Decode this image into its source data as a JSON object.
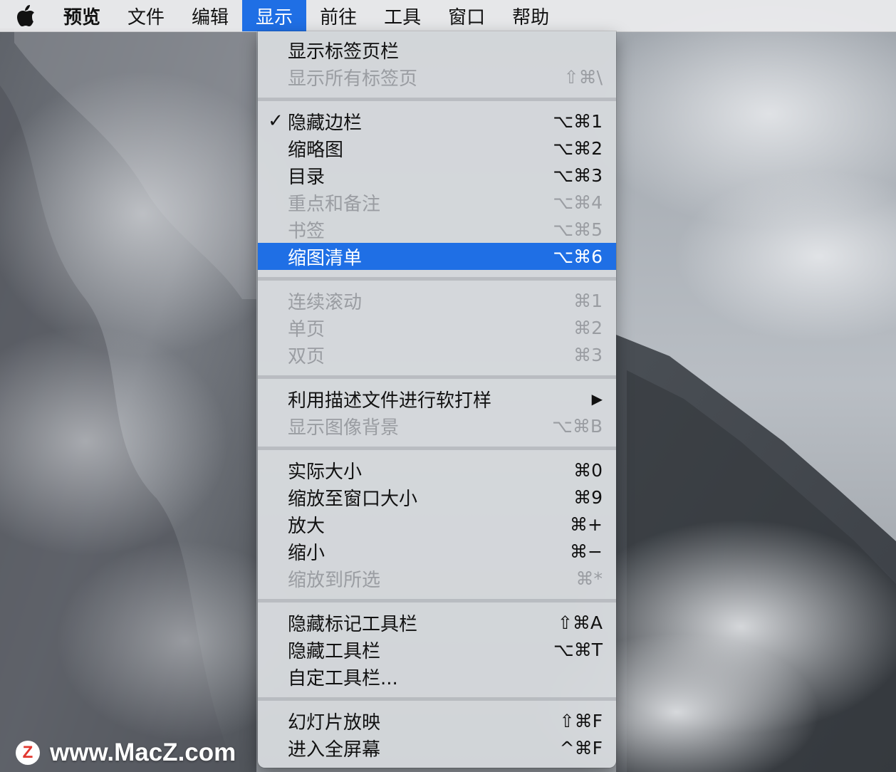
{
  "menubar": {
    "apple_icon": "apple-logo-icon",
    "menus": [
      {
        "label": "预览"
      },
      {
        "label": "文件"
      },
      {
        "label": "编辑"
      },
      {
        "label": "显示"
      },
      {
        "label": "前往"
      },
      {
        "label": "工具"
      },
      {
        "label": "窗口"
      },
      {
        "label": "帮助"
      }
    ],
    "active_menu": "显示",
    "active_color": "#1f6fe5"
  },
  "view_menu": {
    "items": [
      {
        "label": "显示标签页栏",
        "shortcut": "",
        "enabled": true,
        "checked": false
      },
      {
        "label": "显示所有标签页",
        "shortcut": "⇧⌘\\",
        "enabled": false,
        "checked": false
      },
      {
        "label": "隐藏边栏",
        "shortcut": "⌥⌘1",
        "enabled": true,
        "checked": true,
        "check_mark": "✓"
      },
      {
        "label": "缩略图",
        "shortcut": "⌥⌘2",
        "enabled": true,
        "checked": false
      },
      {
        "label": "目录",
        "shortcut": "⌥⌘3",
        "enabled": true,
        "checked": false
      },
      {
        "label": "重点和备注",
        "shortcut": "⌥⌘4",
        "enabled": false,
        "checked": false
      },
      {
        "label": "书签",
        "shortcut": "⌥⌘5",
        "enabled": false,
        "checked": false
      },
      {
        "label": "缩图清单",
        "shortcut": "⌥⌘6",
        "enabled": true,
        "checked": false,
        "highlighted": true
      },
      {
        "label": "连续滚动",
        "shortcut": "⌘1",
        "enabled": false,
        "checked": false
      },
      {
        "label": "单页",
        "shortcut": "⌘2",
        "enabled": false,
        "checked": false
      },
      {
        "label": "双页",
        "shortcut": "⌘3",
        "enabled": false,
        "checked": false
      },
      {
        "label": "利用描述文件进行软打样",
        "shortcut": "▶",
        "enabled": true,
        "checked": false,
        "submenu": true
      },
      {
        "label": "显示图像背景",
        "shortcut": "⌥⌘B",
        "enabled": false,
        "checked": false
      },
      {
        "label": "实际大小",
        "shortcut": "⌘0",
        "enabled": true,
        "checked": false
      },
      {
        "label": "缩放至窗口大小",
        "shortcut": "⌘9",
        "enabled": true,
        "checked": false
      },
      {
        "label": "放大",
        "shortcut": "⌘+",
        "enabled": true,
        "checked": false
      },
      {
        "label": "缩小",
        "shortcut": "⌘−",
        "enabled": true,
        "checked": false
      },
      {
        "label": "缩放到所选",
        "shortcut": "⌘*",
        "enabled": false,
        "checked": false
      },
      {
        "label": "隐藏标记工具栏",
        "shortcut": "⇧⌘A",
        "enabled": true,
        "checked": false
      },
      {
        "label": "隐藏工具栏",
        "shortcut": "⌥⌘T",
        "enabled": true,
        "checked": false
      },
      {
        "label": "自定工具栏...",
        "shortcut": "",
        "enabled": true,
        "checked": false
      },
      {
        "label": "幻灯片放映",
        "shortcut": "⇧⌘F",
        "enabled": true,
        "checked": false
      },
      {
        "label": "进入全屏幕",
        "shortcut": "^⌘F",
        "enabled": true,
        "checked": false
      }
    ],
    "highlight_color": "#1f6fe5"
  },
  "watermark": {
    "logo_letter": "Z",
    "text": "www.MacZ.com"
  }
}
